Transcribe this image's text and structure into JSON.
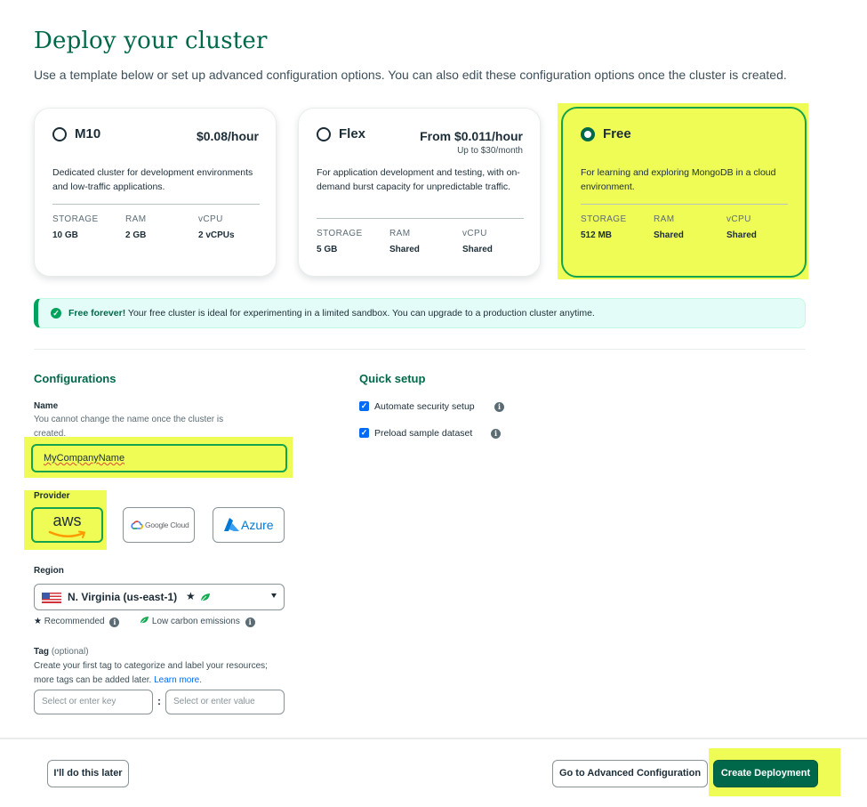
{
  "header": {
    "title": "Deploy your cluster",
    "subtitle": "Use a template below or set up advanced configuration options. You can also edit these configuration options once the cluster is created."
  },
  "tiers": [
    {
      "name": "M10",
      "price": "$0.08/hour",
      "price_note": "",
      "description": "Dedicated cluster for development environments and low-traffic applications.",
      "selected": false,
      "specs": [
        {
          "label": "STORAGE",
          "value": "10 GB"
        },
        {
          "label": "RAM",
          "value": "2 GB"
        },
        {
          "label": "vCPU",
          "value": "2 vCPUs"
        }
      ]
    },
    {
      "name": "Flex",
      "price": "From $0.011/hour",
      "price_note": "Up to $30/month",
      "description": "For application development and testing, with on-demand burst capacity for unpredictable traffic.",
      "selected": false,
      "specs": [
        {
          "label": "STORAGE",
          "value": "5 GB"
        },
        {
          "label": "RAM",
          "value": "Shared"
        },
        {
          "label": "vCPU",
          "value": "Shared"
        }
      ]
    },
    {
      "name": "Free",
      "price": "",
      "price_note": "",
      "description": "For learning and exploring MongoDB in a cloud environment.",
      "selected": true,
      "specs": [
        {
          "label": "STORAGE",
          "value": "512 MB"
        },
        {
          "label": "RAM",
          "value": "Shared"
        },
        {
          "label": "vCPU",
          "value": "Shared"
        }
      ]
    }
  ],
  "banner": {
    "bold": "Free forever!",
    "text": " Your free cluster is ideal for experimenting in a limited sandbox. You can upgrade to a production cluster anytime."
  },
  "configurations": {
    "title": "Configurations",
    "name_label": "Name",
    "name_help": "You cannot change the name once the cluster is created.",
    "name_value": "MyCompanyName",
    "provider_label": "Provider",
    "providers": {
      "aws": "aws",
      "gcp": "Google Cloud",
      "azure": "Azure"
    },
    "selected_provider": "aws",
    "region_label": "Region",
    "region_value": "N. Virginia (us-east-1)",
    "recommended_label": "Recommended",
    "low_carbon_label": "Low carbon emissions",
    "tag_label": "Tag",
    "tag_optional": "(optional)",
    "tag_help": "Create your first tag to categorize and label your resources; more tags can be added later.",
    "learn_more": "Learn more.",
    "tag_key_placeholder": "Select or enter key",
    "tag_separator": ":",
    "tag_value_placeholder": "Select or enter value"
  },
  "quick_setup": {
    "title": "Quick setup",
    "options": [
      {
        "label": "Automate security setup",
        "checked": true
      },
      {
        "label": "Preload sample dataset",
        "checked": true
      }
    ]
  },
  "footer": {
    "later": "I'll do this later",
    "advanced": "Go to Advanced Configuration",
    "create": "Create Deployment"
  },
  "colors": {
    "brand_green": "#00684a",
    "highlight": "#eefc55",
    "checkbox_blue": "#016bf8",
    "aws_orange": "#ff9900",
    "azure_blue": "#0078d4"
  }
}
